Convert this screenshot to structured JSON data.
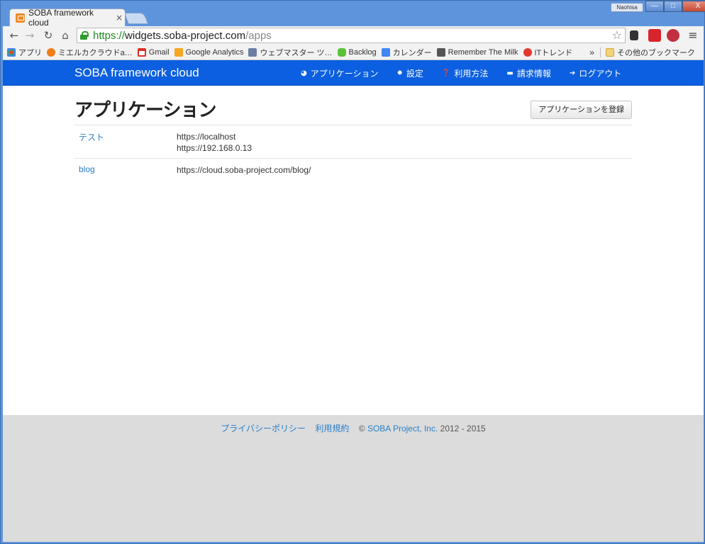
{
  "browser": {
    "tab_title": "SOBA framework cloud",
    "tab_close": "×",
    "user_badge": "Naohisa",
    "window_buttons": {
      "minimize": "—",
      "maximize": "□",
      "close": "X"
    },
    "url": {
      "scheme": "https://",
      "host": "widgets.soba-project.com",
      "path": "/apps"
    }
  },
  "bookmarks": {
    "items": [
      {
        "label": "アプリ",
        "icon_color": "#e94235",
        "icon": "apps-grid-icon"
      },
      {
        "label": "ミエルカクラウドa…",
        "icon_color": "#f07d1a",
        "icon": "mieruka-icon"
      },
      {
        "label": "Gmail",
        "icon_color": "#d93025",
        "icon": "gmail-icon"
      },
      {
        "label": "Google Analytics",
        "icon_color": "#f5a623",
        "icon": "analytics-icon"
      },
      {
        "label": "ウェブマスター ツ…",
        "icon_color": "#6b7fa3",
        "icon": "webmaster-icon"
      },
      {
        "label": "Backlog",
        "icon_color": "#5bc236",
        "icon": "backlog-icon"
      },
      {
        "label": "カレンダー",
        "icon_color": "#4285f4",
        "icon": "calendar-icon"
      },
      {
        "label": "Remember The Milk",
        "icon_color": "#555555",
        "icon": "rtm-icon"
      },
      {
        "label": "ITトレンド",
        "icon_color": "#e2372b",
        "icon": "ittrend-icon"
      }
    ],
    "more": "»",
    "other": "その他のブックマーク"
  },
  "navbar": {
    "brand": "SOBA framework cloud",
    "links": [
      {
        "label": "アプリケーション",
        "icon": "globe-icon",
        "glyph": "◕"
      },
      {
        "label": "設定",
        "icon": "gear-icon",
        "glyph": "✹"
      },
      {
        "label": "利用方法",
        "icon": "question-icon",
        "glyph": "❓"
      },
      {
        "label": "請求情報",
        "icon": "credit-card-icon",
        "glyph": "▬"
      },
      {
        "label": "ログアウト",
        "icon": "arrow-right-icon",
        "glyph": "➔"
      }
    ]
  },
  "main": {
    "title": "アプリケーション",
    "register_button": "アプリケーションを登録",
    "apps": [
      {
        "name": "テスト",
        "urls": [
          "https://localhost",
          "https://192.168.0.13"
        ]
      },
      {
        "name": "blog",
        "urls": [
          "https://cloud.soba-project.com/blog/"
        ]
      }
    ]
  },
  "footer": {
    "privacy": "プライバシーポリシー",
    "terms": "利用規約",
    "copyright_symbol": "©",
    "company": "SOBA Project, Inc.",
    "years": "2012 - 2015"
  },
  "colors": {
    "navbar": "#0b5fe0",
    "link": "#2a7fc9",
    "footer_bg": "#dcdcdc"
  }
}
